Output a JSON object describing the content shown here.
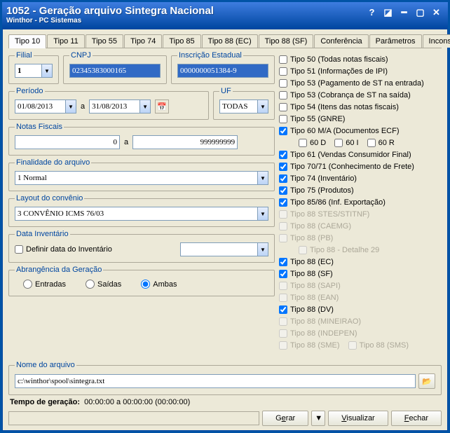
{
  "window": {
    "title": "1052 - Geração arquivo Sintegra Nacional",
    "subtitle": "Winthor - PC Sistemas"
  },
  "tabs": {
    "items": [
      "Tipo 10",
      "Tipo 11",
      "Tipo 55",
      "Tipo 74",
      "Tipo 85",
      "Tipo 88 (EC)",
      "Tipo 88 (SF)",
      "Conferência",
      "Parâmetros",
      "Incons"
    ]
  },
  "filial": {
    "legend": "Filial",
    "value": "1"
  },
  "cnpj": {
    "legend": "CNPJ",
    "value": "02345383000165"
  },
  "ie": {
    "legend": "Inscrição Estadual",
    "value": "0000000051384-9"
  },
  "periodo": {
    "legend": "Período",
    "from": "01/08/2013",
    "sep": "a",
    "to": "31/08/2013"
  },
  "uf": {
    "legend": "UF",
    "value": "TODAS"
  },
  "nf": {
    "legend": "Notas Fiscais",
    "from": "0",
    "sep": "a",
    "to": "999999999"
  },
  "finalidade": {
    "legend": "Finalidade do arquivo",
    "value": "1 Normal"
  },
  "layout": {
    "legend": "Layout do convênio",
    "value": "3 CONVÊNIO ICMS 76/03"
  },
  "datainv": {
    "legend": "Data Inventário",
    "check": "Definir data do Inventário"
  },
  "abrang": {
    "legend": "Abrangência da Geração",
    "entradas": "Entradas",
    "saidas": "Saídas",
    "ambas": "Ambas"
  },
  "checks": [
    {
      "label": "Tipo 50 (Todas notas fiscais)",
      "checked": false,
      "enabled": true
    },
    {
      "label": "Tipo 51 (Informações de IPI)",
      "checked": false,
      "enabled": true
    },
    {
      "label": "Tipo 53 (Pagamento de ST na entrada)",
      "checked": false,
      "enabled": true
    },
    {
      "label": "Tipo 53 (Cobrança de ST na saída)",
      "checked": false,
      "enabled": true
    },
    {
      "label": "Tipo 54 (Itens das notas fiscais)",
      "checked": false,
      "enabled": true
    },
    {
      "label": "Tipo 55 (GNRE)",
      "checked": false,
      "enabled": true
    },
    {
      "label": "Tipo 60 M/A (Documentos ECF)",
      "checked": true,
      "enabled": true
    }
  ],
  "checks60sub": [
    {
      "label": "60 D",
      "checked": false
    },
    {
      "label": "60 I",
      "checked": false
    },
    {
      "label": "60 R",
      "checked": false
    }
  ],
  "checks2": [
    {
      "label": "Tipo 61 (Vendas Consumidor Final)",
      "checked": true,
      "enabled": true
    },
    {
      "label": "Tipo 70/71 (Conhecimento de Frete)",
      "checked": true,
      "enabled": true
    },
    {
      "label": "Tipo 74 (Inventário)",
      "checked": true,
      "enabled": true
    },
    {
      "label": "Tipo 75 (Produtos)",
      "checked": true,
      "enabled": true
    },
    {
      "label": "Tipo 85/86 (Inf. Exportação)",
      "checked": true,
      "enabled": true
    },
    {
      "label": "Tipo 88 STES/STITNF)",
      "checked": false,
      "enabled": false
    },
    {
      "label": "Tipo 88 (CAEMG)",
      "checked": false,
      "enabled": false
    },
    {
      "label": "Tipo 88 (PB)",
      "checked": false,
      "enabled": false
    }
  ],
  "checks88sub": {
    "label": "Tipo 88 - Detalhe 29",
    "checked": false,
    "enabled": false
  },
  "checks3": [
    {
      "label": "Tipo 88 (EC)",
      "checked": true,
      "enabled": true
    },
    {
      "label": "Tipo 88 (SF)",
      "checked": true,
      "enabled": true
    },
    {
      "label": "Tipo 88 (SAPI)",
      "checked": false,
      "enabled": false
    },
    {
      "label": "Tipo 88 (EAN)",
      "checked": false,
      "enabled": false
    },
    {
      "label": "Tipo 88 (DV)",
      "checked": true,
      "enabled": true
    },
    {
      "label": "Tipo 88 (MINEIRAO)",
      "checked": false,
      "enabled": false
    },
    {
      "label": "Tipo 88 (INDEPEN)",
      "checked": false,
      "enabled": false
    }
  ],
  "checks88row": [
    {
      "label": "Tipo 88 (SME)",
      "checked": false,
      "enabled": false
    },
    {
      "label": "Tipo 88 (SMS)",
      "checked": false,
      "enabled": false
    }
  ],
  "file": {
    "legend": "Nome do arquivo",
    "value": "c:\\winthor\\spool\\sintegra.txt"
  },
  "status": {
    "label": "Tempo de geração:",
    "value": "00:00:00   a   00:00:00  (00:00:00)"
  },
  "buttons": {
    "gerar_pre": "G",
    "gerar_u": "e",
    "gerar_post": "rar",
    "visualizar_pre": "",
    "visualizar_u": "V",
    "visualizar_post": "isualizar",
    "fechar_pre": "",
    "fechar_u": "F",
    "fechar_post": "echar"
  }
}
